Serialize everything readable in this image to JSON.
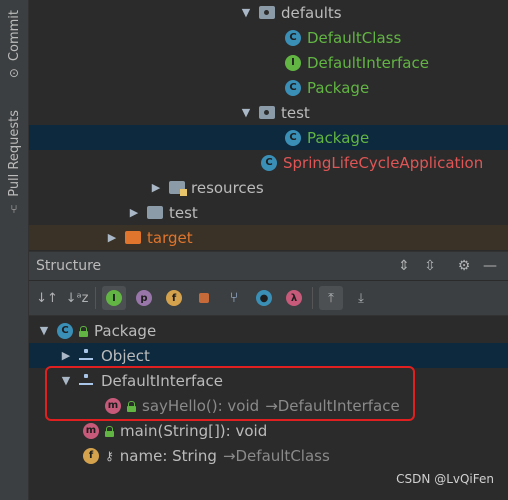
{
  "left_stripe": {
    "tabs": [
      {
        "label": "Commit"
      },
      {
        "label": "Pull Requests"
      }
    ]
  },
  "project_tree": [
    {
      "label": "defaults"
    },
    {
      "label": "DefaultClass"
    },
    {
      "label": "DefaultInterface"
    },
    {
      "label": "Package"
    },
    {
      "label": "test"
    },
    {
      "label": "Package"
    },
    {
      "label": "SpringLifeCycleApplication"
    },
    {
      "label": "resources"
    },
    {
      "label": "test"
    },
    {
      "label": "target"
    }
  ],
  "structure": {
    "title": "Structure",
    "tree": [
      {
        "label": "Package"
      },
      {
        "label": "Object"
      },
      {
        "label": "DefaultInterface"
      },
      {
        "label": "sayHello(): void",
        "suffix": "→DefaultInterface"
      },
      {
        "label": "main(String[]): void"
      },
      {
        "label": "name: String",
        "suffix": "→DefaultClass"
      }
    ]
  },
  "icons": {
    "class": "C",
    "interface": "I",
    "method": "m",
    "field": "f",
    "toolbar_inherited": "I",
    "toolbar_properties": "p",
    "toolbar_fields": "f",
    "toolbar_lambda": "λ"
  },
  "colors": {
    "background": "#2b2b2b",
    "selection": "#0d293e",
    "highlight_box": "#e02020",
    "green": "#62b543",
    "red": "#e05555"
  },
  "watermark": "CSDN @LvQiFen"
}
